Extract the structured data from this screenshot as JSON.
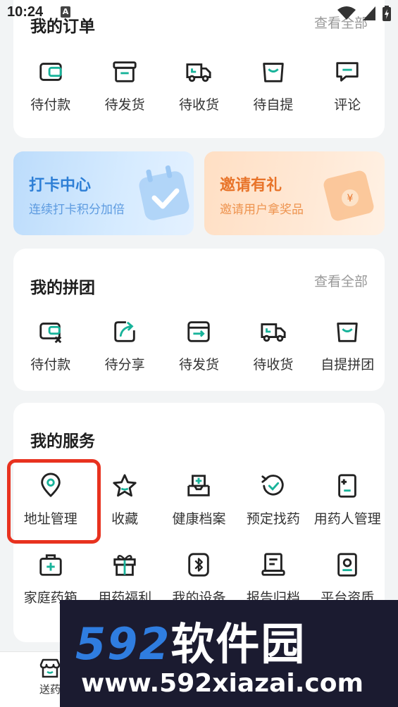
{
  "status_bar": {
    "time": "10:24",
    "notification": "A"
  },
  "orders": {
    "title": "我的订单",
    "more": "查看全部",
    "items": [
      {
        "label": "待付款",
        "icon": "wallet-icon"
      },
      {
        "label": "待发货",
        "icon": "package-icon"
      },
      {
        "label": "待收货",
        "icon": "truck-icon"
      },
      {
        "label": "待自提",
        "icon": "bag-icon"
      },
      {
        "label": "评论",
        "icon": "comment-icon"
      }
    ]
  },
  "promos": {
    "checkin": {
      "title": "打卡中心",
      "subtitle": "连续打卡积分加倍"
    },
    "invite": {
      "title": "邀请有礼",
      "subtitle": "邀请用户拿奖品"
    }
  },
  "group": {
    "title": "我的拼团",
    "more": "查看全部",
    "items": [
      {
        "label": "待付款",
        "icon": "wallet-cancel-icon"
      },
      {
        "label": "待分享",
        "icon": "share-icon"
      },
      {
        "label": "待发货",
        "icon": "box-arrow-icon"
      },
      {
        "label": "待收货",
        "icon": "truck-icon"
      },
      {
        "label": "自提拼团",
        "icon": "bag-icon"
      }
    ]
  },
  "services": {
    "title": "我的服务",
    "row1": [
      {
        "label": "地址管理",
        "icon": "location-pin-icon"
      },
      {
        "label": "收藏",
        "icon": "star-icon"
      },
      {
        "label": "健康档案",
        "icon": "health-record-icon"
      },
      {
        "label": "预定找药",
        "icon": "refresh-check-icon"
      },
      {
        "label": "用药人管理",
        "icon": "medicine-user-icon"
      }
    ],
    "row2": [
      {
        "label": "家庭药箱",
        "icon": "medicine-box-icon"
      },
      {
        "label": "用药福利",
        "icon": "gift-icon"
      },
      {
        "label": "我的设备",
        "icon": "bluetooth-icon"
      },
      {
        "label": "报告归档",
        "icon": "report-icon"
      },
      {
        "label": "平台资质",
        "icon": "certificate-icon"
      }
    ]
  },
  "bottom_nav": {
    "label": "送药"
  },
  "watermark": {
    "brand_num": "592",
    "brand_cn": "软件园",
    "url": "www.592xiazai.com"
  },
  "colors": {
    "accent": "#18b39a",
    "highlight": "#e8321f",
    "promo_blue": "#2e7fd6",
    "promo_orange": "#e8742a"
  }
}
